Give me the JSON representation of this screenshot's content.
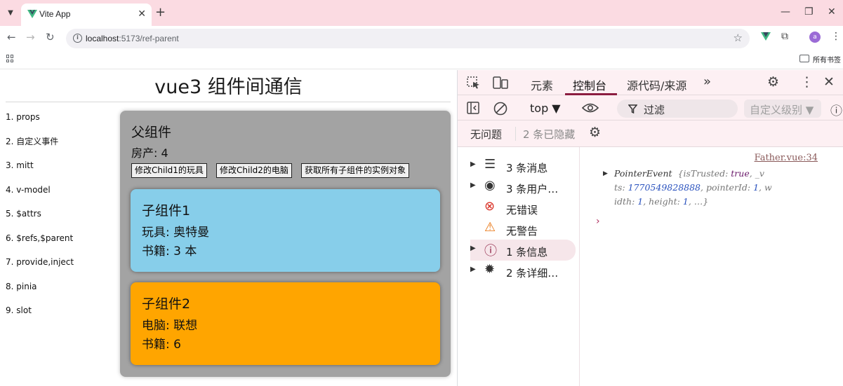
{
  "browser": {
    "tab_title": "Vite App",
    "tab_close": "✕",
    "new_tab": "+",
    "url_host": "localhost",
    "url_path": ":5173/ref-parent",
    "bookmarks_label": "所有书签",
    "avatar_letter": "a",
    "window_controls": [
      "—",
      "❐",
      "✕"
    ]
  },
  "page": {
    "title": "vue3 组件间通信",
    "nav": [
      "1. props",
      "2. 自定义事件",
      "3. mitt",
      "4. v-model",
      "5. $attrs",
      "6. $refs,$parent",
      "7. provide,inject",
      "8. pinia",
      "9. slot"
    ],
    "parent": {
      "title": "父组件",
      "house": "房产: 4",
      "buttons": [
        "修改Child1的玩具",
        "修改Child2的电脑",
        "获取所有子组件的实例对象"
      ],
      "bg_color": "#a3a3a3"
    },
    "child1": {
      "title": "子组件1",
      "line1": "玩具: 奥特曼",
      "line2": "书籍: 3 本",
      "bg_color": "#87ceea"
    },
    "child2": {
      "title": "子组件2",
      "line1": "电脑: 联想",
      "line2": "书籍: 6",
      "bg_color": "#ffa500"
    }
  },
  "devtools": {
    "tabs": [
      "元素",
      "控制台",
      "源代码/来源"
    ],
    "active_tab": "控制台",
    "more_tabs": "»",
    "context": "top",
    "filter_placeholder": "过滤",
    "level": "自定义级别",
    "issues_none": "无问题",
    "hidden_count": "2 条已隐藏",
    "sidebar": [
      {
        "label": "3 条消息",
        "icon": "list-icon"
      },
      {
        "label": "3 条用户…",
        "icon": "user-icon"
      },
      {
        "label": "无错误",
        "icon": "error-icon"
      },
      {
        "label": "无警告",
        "icon": "warning-icon"
      },
      {
        "label": "1 条信息",
        "icon": "info-icon"
      },
      {
        "label": "2 条详细…",
        "icon": "bug-icon"
      }
    ],
    "console": {
      "source_link": "Father.vue:34",
      "log_type": "PointerEvent",
      "log_body_1": "{isTrusted: ",
      "log_true": "true",
      "log_body_2": ", _v",
      "log_line2_a": "ts: ",
      "log_ts": "1770549828888",
      "log_line2_b": ", pointerId: ",
      "log_pid": "1",
      "log_line2_c": ", w",
      "log_line3_a": "idth: ",
      "log_width": "1",
      "log_line3_b": ", height: ",
      "log_height": "1",
      "log_line3_c": ",  …}",
      "prompt": "›"
    }
  }
}
